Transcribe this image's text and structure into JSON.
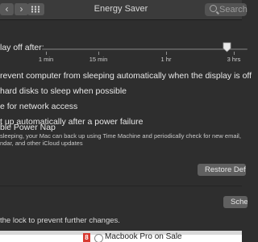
{
  "window": {
    "title": "Energy Saver"
  },
  "toolbar": {
    "back": "‹",
    "forward": "›",
    "search_placeholder": "Search"
  },
  "slider": {
    "label": "lay off after:",
    "ticks": [
      "1 min",
      "15 min",
      "1 hr",
      "3 hrs"
    ],
    "value_fraction": 0.9
  },
  "options": [
    {
      "label": "revent computer from sleeping automatically when the display is off"
    },
    {
      "label": "hard disks to sleep when possible"
    },
    {
      "label": "e for network access"
    },
    {
      "label": "t up automatically after a power failure"
    },
    {
      "label": "ble Power Nap"
    }
  ],
  "power_nap_description": [
    "sleeping, your Mac can back up using Time Machine and periodically check for new email,",
    "ndar, and other iCloud updates"
  ],
  "buttons": {
    "restore_defaults": "Restore Defaults",
    "schedule": "Schedule..."
  },
  "lock": {
    "text": "the lock to prevent further changes."
  },
  "web": {
    "badge": "8",
    "promo": "Macbook Pro on Sale"
  }
}
